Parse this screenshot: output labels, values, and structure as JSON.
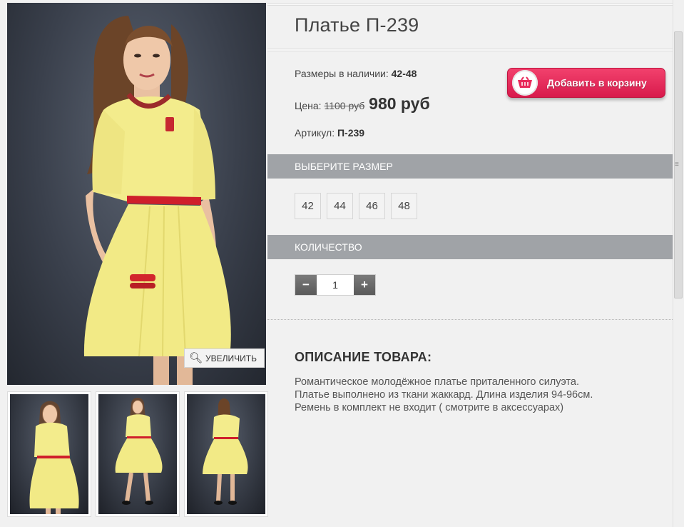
{
  "product": {
    "title": "Платье П-239",
    "sizes_label": "Размеры в наличии:",
    "sizes_value": "42-48",
    "price_label": "Цена:",
    "old_price": "1100 руб",
    "new_price": "980 руб",
    "article_label": "Артикул:",
    "article_value": "П-239"
  },
  "cart": {
    "button_label": "Добавить в корзину",
    "icon": "basket-icon",
    "color": "#e8295a"
  },
  "size_section": {
    "title": "ВЫБЕРИТЕ РАЗМЕР",
    "options": [
      "42",
      "44",
      "46",
      "48"
    ]
  },
  "quantity_section": {
    "title": "КОЛИЧЕСТВО",
    "minus": "−",
    "plus": "+",
    "value": "1"
  },
  "gallery": {
    "zoom_label": "УВЕЛИЧИТЬ",
    "zoom_icon": "magnifier-icon",
    "thumbnails": 3
  },
  "description": {
    "title": "ОПИСАНИЕ ТОВАРА:",
    "lines": [
      "Романтическое молодёжное платье приталенного силуэта.",
      "Платье выполнено из ткани жаккард. Длина изделия 94-96см.",
      "Ремень в комплект не входит ( смотрите в аксессуарах)"
    ]
  },
  "colors": {
    "section_bar": "#a0a3a7",
    "dress": "#f3ec8c",
    "belt": "#cf1f2b"
  }
}
